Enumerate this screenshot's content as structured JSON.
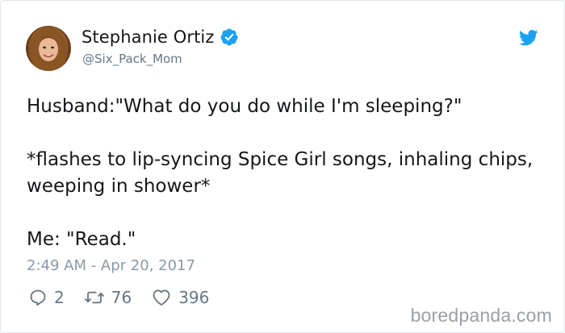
{
  "user": {
    "display_name": "Stephanie Ortiz",
    "handle": "@Six_Pack_Mom",
    "verified": true
  },
  "tweet": {
    "text": "Husband:\"What do you do while I'm sleeping?\"\n\n*flashes to lip-syncing Spice Girl songs, inhaling chips, weeping in shower*\n\nMe: \"Read.\"",
    "timestamp": "2:49 AM - Apr 20, 2017"
  },
  "actions": {
    "replies": "2",
    "retweets": "76",
    "likes": "396"
  },
  "icons": {
    "avatar": "profile-photo",
    "verified": "verified-badge-icon",
    "brand": "twitter-bird-icon",
    "reply": "reply-icon",
    "retweet": "retweet-icon",
    "like": "heart-icon"
  },
  "colors": {
    "twitter_blue": "#1da1f2",
    "muted_text": "#657786",
    "timestamp_text": "#8899a6",
    "border": "#e1e8ed"
  },
  "watermark": "boredpanda.com"
}
